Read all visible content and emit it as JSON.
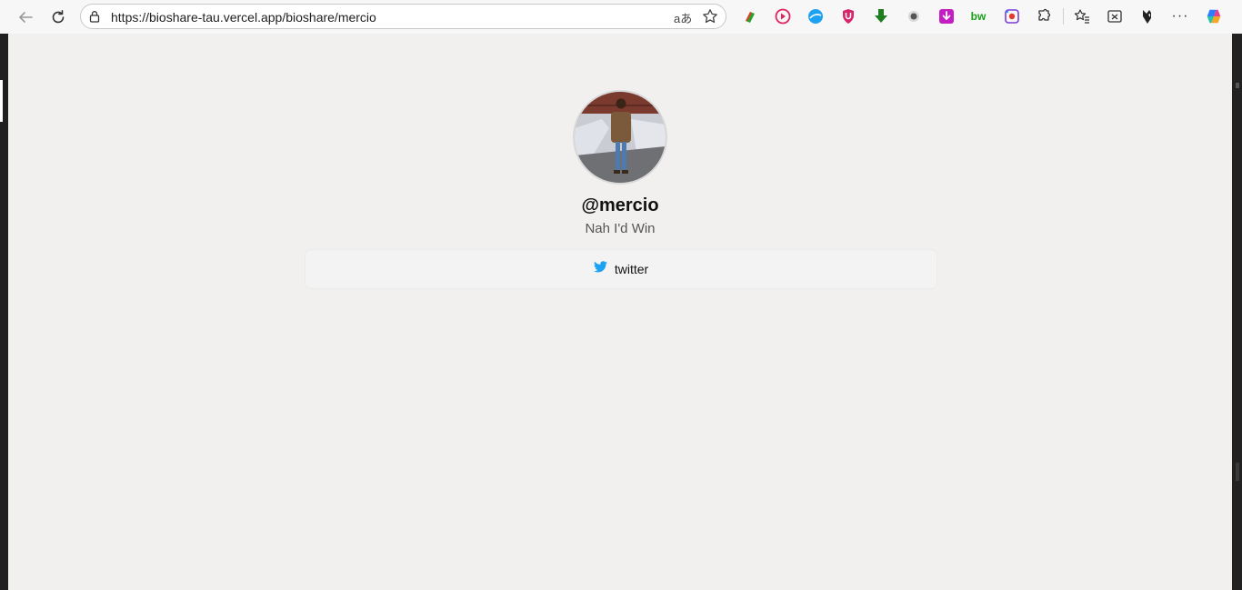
{
  "browser": {
    "url": "https://bioshare-tau.vercel.app/bioshare/mercio",
    "translate_glyph": "aあ",
    "icons": [
      "back-icon",
      "reload-icon",
      "lock-icon",
      "translate-icon",
      "favorite-star-icon"
    ],
    "extensions": [
      {
        "name": "extension-tag-icon",
        "color": "#e23b2e"
      },
      {
        "name": "extension-play-icon",
        "color": "#e0245e"
      },
      {
        "name": "extension-ball-icon",
        "color": "#1da1f2"
      },
      {
        "name": "extension-shield-icon",
        "color": "#d6266b"
      },
      {
        "name": "extension-download-arrow-icon",
        "color": "#1e7d1e"
      },
      {
        "name": "extension-record-icon",
        "color": "#555555"
      },
      {
        "name": "extension-download-box-icon",
        "color": "#c21ec2"
      },
      {
        "name": "extension-bw-icon",
        "color": "#18a018",
        "text": "bw"
      },
      {
        "name": "extension-camera-icon",
        "color": "#7a3dd6"
      },
      {
        "name": "extensions-puzzle-icon",
        "color": "#333333"
      },
      {
        "name": "favorites-icon",
        "color": "#333333"
      },
      {
        "name": "screenshot-icon",
        "color": "#333333"
      },
      {
        "name": "profile-wolf-icon",
        "color": "#222222"
      },
      {
        "name": "more-menu-icon",
        "color": "#333333",
        "text": "···"
      },
      {
        "name": "copilot-icon",
        "color": "#4a7bff"
      }
    ]
  },
  "profile": {
    "handle": "@mercio",
    "bio": "Nah I'd Win",
    "avatar_icon": "profile-photo"
  },
  "links": [
    {
      "label": "twitter",
      "icon": "twitter-bird-icon",
      "icon_color": "#1da1f2"
    }
  ],
  "colors": {
    "page_bg": "#f1f0ee",
    "card_bg": "#f3f3f3"
  }
}
